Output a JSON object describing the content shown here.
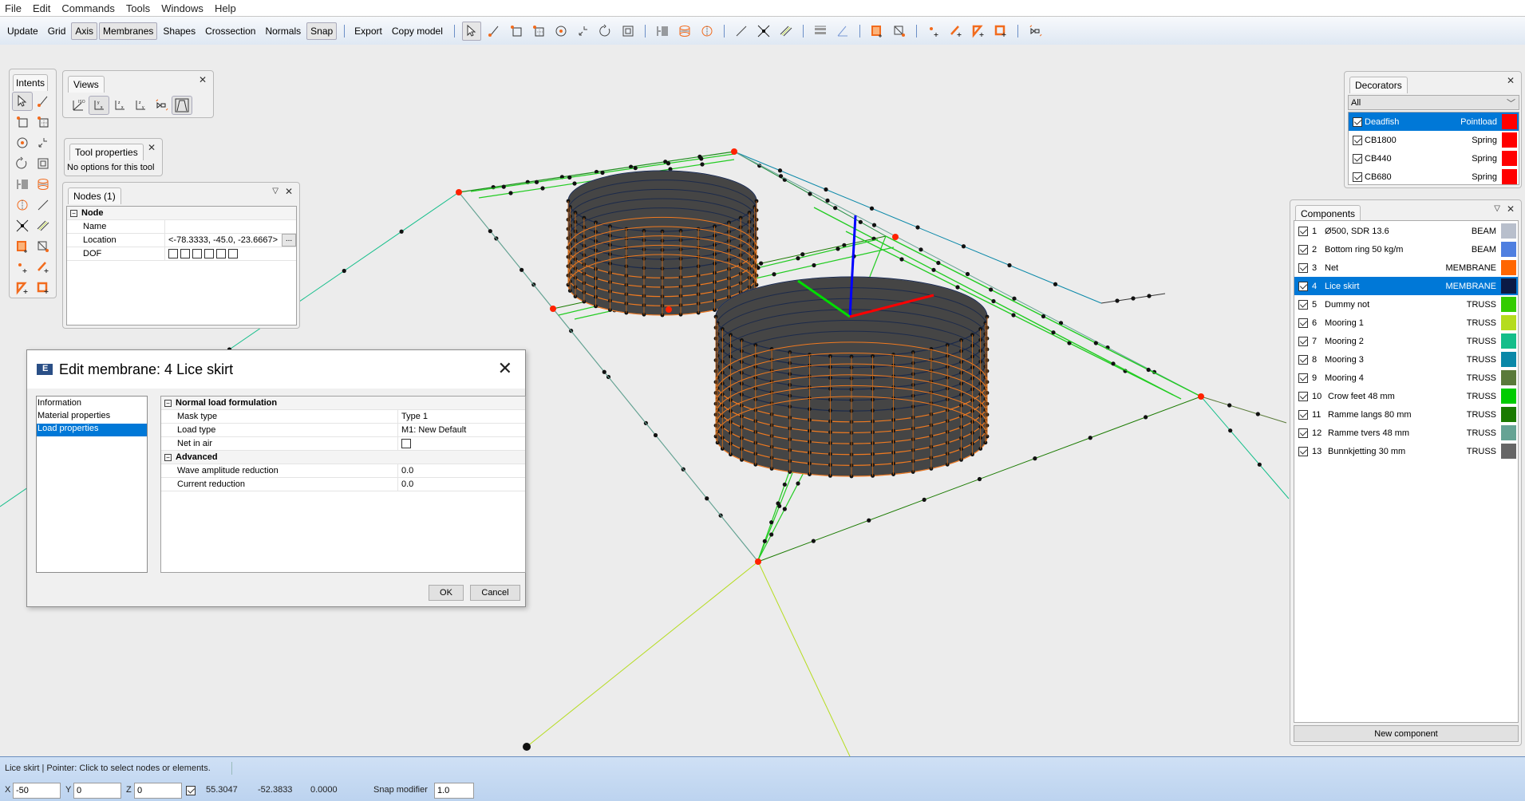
{
  "menu": [
    "File",
    "Edit",
    "Commands",
    "Tools",
    "Windows",
    "Help"
  ],
  "toolbar": {
    "buttons": [
      {
        "label": "Update",
        "checked": false
      },
      {
        "label": "Grid",
        "checked": false
      },
      {
        "label": "Axis",
        "checked": true
      },
      {
        "label": "Membranes",
        "checked": true
      },
      {
        "label": "Shapes",
        "checked": false
      },
      {
        "label": "Crossection",
        "checked": false
      },
      {
        "label": "Normals",
        "checked": false
      },
      {
        "label": "Snap",
        "checked": true
      }
    ],
    "buttons2": [
      {
        "label": "Export"
      },
      {
        "label": "Copy model"
      }
    ],
    "icons": [
      "pointer-icon",
      "add-line-icon",
      "add-node-box-icon",
      "add-grid-icon",
      "center-node-icon",
      "move-icon",
      "rotate-icon",
      "scale-icon",
      "sep",
      "array-icon",
      "cylinder-icon",
      "split-circle-icon",
      "sep",
      "line-icon",
      "cross-node-icon",
      "parallel-lines-icon",
      "sep",
      "stack-icon",
      "angle-icon",
      "sep",
      "add-membrane-icon",
      "diagonal-membrane-icon",
      "sep",
      "add-point-icon",
      "add-truss-icon",
      "add-triangle-icon",
      "add-square-icon",
      "sep",
      "camera-view-icon"
    ]
  },
  "intents": {
    "title": "Intents",
    "icons": [
      "pointer-icon",
      "add-line-icon",
      "add-node-box-icon",
      "add-grid-icon",
      "center-node-icon",
      "move-icon",
      "rotate-icon",
      "scale-icon",
      "array-icon",
      "cylinder-icon",
      "split-circle-icon",
      "line-icon",
      "cross-node-icon",
      "parallel-lines-icon",
      "add-membrane-icon",
      "diagonal-membrane-icon",
      "add-point-icon",
      "add-truss-icon",
      "add-triangle-icon",
      "add-square-icon"
    ]
  },
  "views": {
    "title": "Views",
    "icons": [
      "iso-view-icon",
      "yx-view-icon",
      "zx-view-icon",
      "zy-view-icon",
      "camera-view-icon",
      "perspective-view-icon"
    ]
  },
  "tool_properties": {
    "title": "Tool properties",
    "text": "No options for this tool"
  },
  "nodes": {
    "title": "Nodes (1)",
    "group": "Node",
    "rows": [
      {
        "key": "Name",
        "value": ""
      },
      {
        "key": "Location",
        "value": "<-78.3333, -45.0, -23.6667>"
      },
      {
        "key": "DOF",
        "value": ""
      }
    ],
    "dof_count": 6,
    "browse_label": "..."
  },
  "dialog": {
    "title": "Edit membrane: 4 Lice skirt",
    "nav": [
      {
        "label": "Information",
        "selected": false
      },
      {
        "label": "Material properties",
        "selected": false
      },
      {
        "label": "Load properties",
        "selected": true
      }
    ],
    "groups": [
      {
        "name": "Normal load formulation",
        "rows": [
          {
            "key": "Mask type",
            "value": "Type 1"
          },
          {
            "key": "Load type",
            "value": "M1: New Default"
          },
          {
            "key": "Net in air",
            "value": "",
            "checkbox": true
          }
        ]
      },
      {
        "name": "Advanced",
        "rows": [
          {
            "key": "Wave amplitude reduction",
            "value": "0.0"
          },
          {
            "key": "Current reduction",
            "value": "0.0"
          }
        ]
      }
    ],
    "ok_label": "OK",
    "cancel_label": "Cancel"
  },
  "decorators": {
    "title": "Decorators",
    "filter": "All",
    "items": [
      {
        "name": "Deadfish",
        "type": "Pointload",
        "color": "#ff0000",
        "checked": true,
        "selected": true
      },
      {
        "name": "CB1800",
        "type": "Spring",
        "color": "#ff0000",
        "checked": true,
        "selected": false
      },
      {
        "name": "CB440",
        "type": "Spring",
        "color": "#ff0000",
        "checked": true,
        "selected": false
      },
      {
        "name": "CB680",
        "type": "Spring",
        "color": "#ff0000",
        "checked": true,
        "selected": false
      }
    ]
  },
  "components": {
    "title": "Components",
    "new_label": "New component",
    "items": [
      {
        "id": "1",
        "name": "Ø500, SDR 13.6",
        "type": "BEAM",
        "color": "#b8bfcc",
        "checked": true,
        "selected": false
      },
      {
        "id": "2",
        "name": "Bottom ring 50 kg/m",
        "type": "BEAM",
        "color": "#4f7fe0",
        "checked": true,
        "selected": false
      },
      {
        "id": "3",
        "name": "Net",
        "type": "MEMBRANE",
        "color": "#ff6600",
        "checked": true,
        "selected": false
      },
      {
        "id": "4",
        "name": "Lice skirt",
        "type": "MEMBRANE",
        "color": "#0b1a45",
        "checked": true,
        "selected": true
      },
      {
        "id": "5",
        "name": "Dummy not",
        "type": "TRUSS",
        "color": "#33cc00",
        "checked": true,
        "selected": false
      },
      {
        "id": "6",
        "name": "Mooring 1",
        "type": "TRUSS",
        "color": "#b5dc1e",
        "checked": true,
        "selected": false
      },
      {
        "id": "7",
        "name": "Mooring 2",
        "type": "TRUSS",
        "color": "#14be8a",
        "checked": true,
        "selected": false
      },
      {
        "id": "8",
        "name": "Mooring 3",
        "type": "TRUSS",
        "color": "#0a88a8",
        "checked": true,
        "selected": false
      },
      {
        "id": "9",
        "name": "Mooring 4",
        "type": "TRUSS",
        "color": "#5a7a3a",
        "checked": true,
        "selected": false
      },
      {
        "id": "10",
        "name": "Crow feet 48 mm",
        "type": "TRUSS",
        "color": "#00cc00",
        "checked": true,
        "selected": false
      },
      {
        "id": "11",
        "name": "Ramme langs 80 mm",
        "type": "TRUSS",
        "color": "#1a7a00",
        "checked": true,
        "selected": false
      },
      {
        "id": "12",
        "name": "Ramme tvers 48 mm",
        "type": "TRUSS",
        "color": "#66a394",
        "checked": true,
        "selected": false
      },
      {
        "id": "13",
        "name": "Bunnkjetting 30 mm",
        "type": "TRUSS",
        "color": "#666666",
        "checked": true,
        "selected": false
      }
    ]
  },
  "status": {
    "message": "Lice skirt  |  Pointer: Click to select nodes or elements.",
    "x_label": "X",
    "x_value": "-50",
    "y_label": "Y",
    "y_value": "0",
    "z_label": "Z",
    "z_value": "0",
    "snap_checked": true,
    "coord1": "55.3047",
    "coord2": "-52.3833",
    "coord3": "0.0000",
    "snap_label": "Snap modifier",
    "snap_value": "1.0"
  },
  "colors": {
    "selection": "#0078d7",
    "node": "#111111",
    "fixed_node": "#ff2200",
    "cylinder_fill": "#454545",
    "net_line": "#f07a20",
    "rope": "#22cc22",
    "axis_x": "#ff0000",
    "axis_y": "#00dd00",
    "axis_z": "#0000ff"
  }
}
